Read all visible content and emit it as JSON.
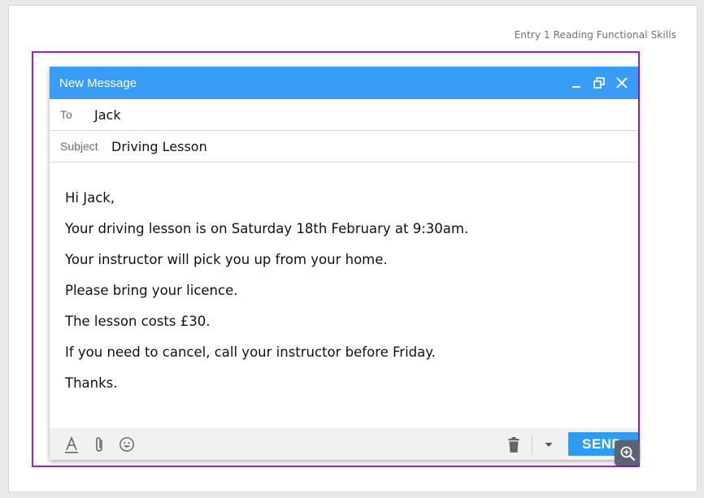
{
  "page": {
    "header_note": "Entry 1 Reading Functional Skills"
  },
  "window": {
    "title": "New Message",
    "controls": {
      "minimize_icon": "minimize-icon",
      "restore_icon": "restore-icon",
      "close_icon": "close-icon"
    }
  },
  "fields": {
    "to_label": "To",
    "to_value": "Jack",
    "subject_label": "Subject",
    "subject_value": "Driving Lesson"
  },
  "message": {
    "lines": [
      "Hi Jack,",
      "Your driving lesson is on Saturday 18th February at 9:30am.",
      "Your instructor will pick you up from your home.",
      "Please bring your licence.",
      "The lesson costs £30.",
      "If you need to cancel, call your instructor before Friday.",
      "Thanks."
    ]
  },
  "toolbar": {
    "send_label": "SEND",
    "icons": [
      "text-format-icon",
      "attach-icon",
      "emoji-icon",
      "trash-icon",
      "dropdown-arrow-icon",
      "zoom-icon"
    ]
  },
  "colors": {
    "title_bar": "#399cf6",
    "send_button": "#2f9cf4",
    "frame_border": "#a21ed6"
  }
}
